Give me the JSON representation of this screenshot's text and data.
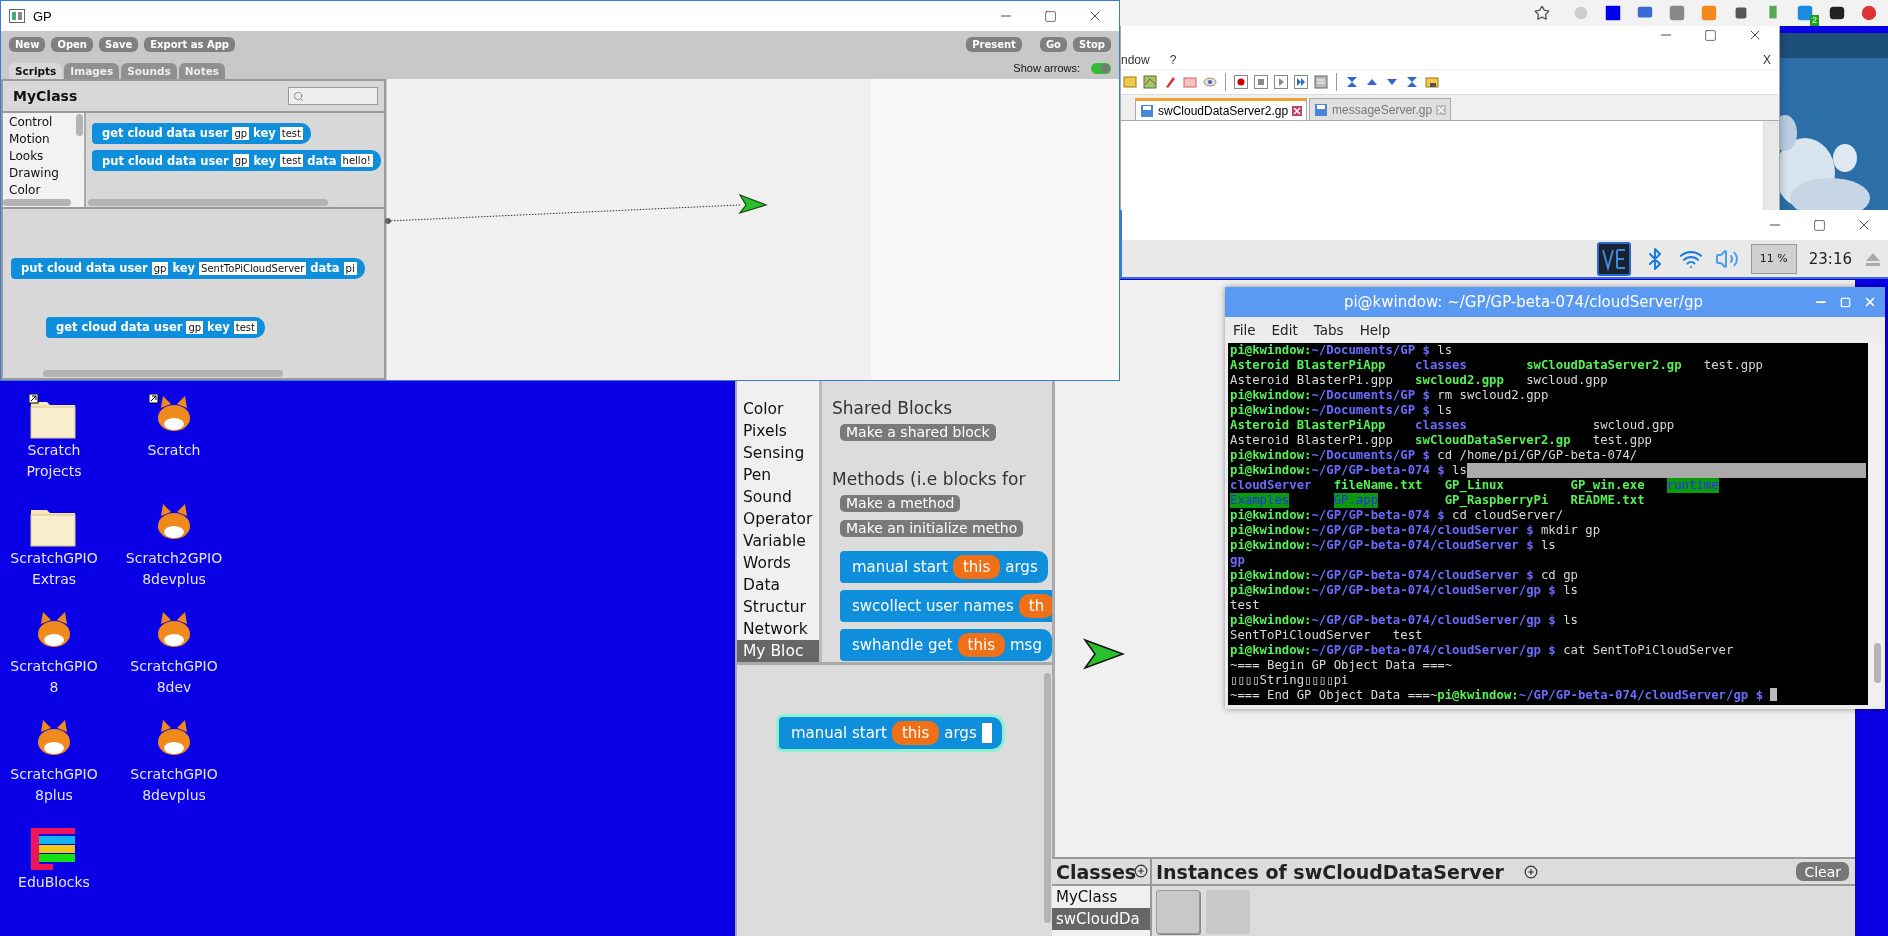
{
  "gp_window": {
    "title": "GP",
    "toolbar_left": [
      "New",
      "Open",
      "Save",
      "Export as App"
    ],
    "toolbar_right": [
      "Present",
      "Go",
      "Stop"
    ],
    "show_arrows": {
      "label": "Show arrows:",
      "on": true
    },
    "tabs": [
      {
        "label": "Scripts",
        "selected": true
      },
      {
        "label": "Images",
        "selected": false
      },
      {
        "label": "Sounds",
        "selected": false
      },
      {
        "label": "Notes",
        "selected": false
      }
    ],
    "class_name": "MyClass",
    "categories": [
      "Control",
      "Motion",
      "Looks",
      "Drawing",
      "Color"
    ],
    "palette_blocks": [
      {
        "parts": [
          {
            "kind": "label",
            "text": "get cloud data user"
          },
          {
            "kind": "slot",
            "text": "gp"
          },
          {
            "kind": "label",
            "text": "key"
          },
          {
            "kind": "slot",
            "text": "test"
          }
        ]
      },
      {
        "parts": [
          {
            "kind": "label",
            "text": "put cloud data user"
          },
          {
            "kind": "slot",
            "text": "gp"
          },
          {
            "kind": "label",
            "text": "key"
          },
          {
            "kind": "slot",
            "text": "test"
          },
          {
            "kind": "label",
            "text": "data"
          },
          {
            "kind": "slot",
            "text": "hello!"
          }
        ]
      }
    ],
    "script_blocks": [
      {
        "parts": [
          {
            "kind": "label",
            "text": "put cloud data user"
          },
          {
            "kind": "slot",
            "text": "gp"
          },
          {
            "kind": "label",
            "text": "key"
          },
          {
            "kind": "slot",
            "text": "SentToPiCloudServer"
          },
          {
            "kind": "label",
            "text": "data"
          },
          {
            "kind": "slot",
            "text": "pi"
          }
        ]
      },
      {
        "parts": [
          {
            "kind": "label",
            "text": "get cloud data user"
          },
          {
            "kind": "slot",
            "text": "gp"
          },
          {
            "kind": "label",
            "text": "key"
          },
          {
            "kind": "slot",
            "text": "test"
          }
        ]
      }
    ]
  },
  "browser": {
    "badge": "2"
  },
  "editor": {
    "menu": [
      "ndow",
      "?"
    ],
    "close_label": "X",
    "tabs": [
      {
        "label": "swCloudDataServer2.gp",
        "selected": true
      },
      {
        "label": "messageServer.gp",
        "selected": false
      }
    ]
  },
  "pi_panel": {
    "cpu": "11 %",
    "clock": "23:16"
  },
  "desktop": {
    "icons": [
      {
        "kind": "folder",
        "shortcut": true,
        "lines": [
          "Scratch",
          "Projects"
        ]
      },
      {
        "kind": "cat",
        "shortcut": true,
        "lines": [
          "Scratch"
        ]
      },
      {
        "kind": "folder",
        "shortcut": false,
        "lines": [
          "ScratchGPIO",
          "Extras"
        ]
      },
      {
        "kind": "cat",
        "shortcut": false,
        "lines": [
          "Scratch2GPIO",
          "8devplus"
        ]
      },
      {
        "kind": "cat",
        "shortcut": false,
        "lines": [
          "ScratchGPIO",
          "8"
        ]
      },
      {
        "kind": "cat",
        "shortcut": false,
        "lines": [
          "ScratchGPIO",
          "8dev"
        ]
      },
      {
        "kind": "cat",
        "shortcut": false,
        "lines": [
          "ScratchGPIO",
          "8plus"
        ]
      },
      {
        "kind": "cat",
        "shortcut": false,
        "lines": [
          "ScratchGPIO",
          "8devplus"
        ]
      },
      {
        "kind": "edublocks",
        "shortcut": false,
        "lines": [
          "EduBlocks"
        ]
      }
    ]
  },
  "pi_gp": {
    "categories": [
      {
        "label": "Color",
        "selected": false
      },
      {
        "label": "Pixels",
        "selected": false
      },
      {
        "label": "Sensing",
        "selected": false
      },
      {
        "label": "Pen",
        "selected": false
      },
      {
        "label": "Sound",
        "selected": false
      },
      {
        "label": "Operator",
        "selected": false
      },
      {
        "label": "Variable",
        "selected": false
      },
      {
        "label": "Words",
        "selected": false
      },
      {
        "label": "Data",
        "selected": false
      },
      {
        "label": "Structur",
        "selected": false
      },
      {
        "label": "Network",
        "selected": false
      },
      {
        "label": "My Bloc",
        "selected": true
      }
    ],
    "shared_heading": "Shared Blocks",
    "shared_button": "Make a shared block",
    "methods_heading": "Methods (i.e blocks for",
    "method_buttons": [
      "Make a method",
      "Make an initialize metho"
    ],
    "palette_blocks": [
      {
        "parts": [
          {
            "kind": "label",
            "text": "manual start"
          },
          {
            "kind": "var",
            "text": "this"
          },
          {
            "kind": "label",
            "text": "args"
          }
        ]
      },
      {
        "parts": [
          {
            "kind": "label",
            "text": "swcollect user names"
          },
          {
            "kind": "var",
            "text": "th"
          }
        ]
      },
      {
        "parts": [
          {
            "kind": "label",
            "text": "swhandle get"
          },
          {
            "kind": "var",
            "text": "this"
          },
          {
            "kind": "label",
            "text": "msg"
          }
        ]
      }
    ],
    "script_blocks": [
      {
        "highlighted": true,
        "parts": [
          {
            "kind": "label",
            "text": "manual start"
          },
          {
            "kind": "var",
            "text": "this"
          },
          {
            "kind": "label",
            "text": "args"
          },
          {
            "kind": "empty"
          }
        ]
      }
    ],
    "classes": {
      "title": "Classes",
      "items": [
        {
          "label": "MyClass",
          "selected": false
        },
        {
          "label": "swCloudDa",
          "selected": true
        }
      ]
    },
    "instances": {
      "title": "Instances of swCloudDataServer",
      "clear": "Clear",
      "items": [
        {
          "selected": true
        },
        {
          "selected": false
        }
      ]
    }
  },
  "terminal": {
    "title": "pi@kwindow: ~/GP/GP-beta-074/cloudServer/gp",
    "menu": [
      "File",
      "Edit",
      "Tabs",
      "Help"
    ],
    "lines": [
      {
        "segments": [
          {
            "kind": "user",
            "text": "pi@kwindow:"
          },
          {
            "kind": "path",
            "text": "~/Documents/GP $"
          },
          {
            "kind": "plain",
            "text": " ls"
          }
        ]
      },
      {
        "cells": [
          {
            "kind": "exec",
            "text": "Asteroid BlasterPiApp"
          },
          {
            "kind": "dir",
            "text": "classes"
          },
          {
            "kind": "exec",
            "text": "swCloudDataServer2.gp"
          },
          {
            "kind": "plain",
            "text": "test.gpp"
          }
        ]
      },
      {
        "cells": [
          {
            "kind": "plain",
            "text": "Asteroid BlasterPi.gpp"
          },
          {
            "kind": "exec",
            "text": "swcloud2.gpp"
          },
          {
            "kind": "plain",
            "text": "swcloud.gpp"
          }
        ]
      },
      {
        "segments": [
          {
            "kind": "user",
            "text": "pi@kwindow:"
          },
          {
            "kind": "path",
            "text": "~/Documents/GP $"
          },
          {
            "kind": "plain",
            "text": " rm swcloud2.gpp"
          }
        ]
      },
      {
        "segments": [
          {
            "kind": "user",
            "text": "pi@kwindow:"
          },
          {
            "kind": "path",
            "text": "~/Documents/GP $"
          },
          {
            "kind": "plain",
            "text": " ls"
          }
        ]
      },
      {
        "cells": [
          {
            "kind": "exec",
            "text": "Asteroid BlasterPiApp"
          },
          {
            "kind": "dir",
            "text": "classes"
          },
          {
            "kind": "plain",
            "text": "swcloud.gpp"
          }
        ]
      },
      {
        "cells": [
          {
            "kind": "plain",
            "text": "Asteroid BlasterPi.gpp"
          },
          {
            "kind": "exec",
            "text": "swCloudDataServer2.gp"
          },
          {
            "kind": "plain",
            "text": "test.gpp"
          }
        ]
      },
      {
        "segments": [
          {
            "kind": "user",
            "text": "pi@kwindow:"
          },
          {
            "kind": "path",
            "text": "~/Documents/GP $"
          },
          {
            "kind": "plain",
            "text": " cd /home/pi/GP/GP-beta-074/"
          }
        ]
      },
      {
        "selection": true,
        "segments": [
          {
            "kind": "user",
            "text": "pi@kwindow:"
          },
          {
            "kind": "path",
            "text": "~/GP/GP-beta-074 $"
          },
          {
            "kind": "plain",
            "text": " ls"
          }
        ]
      },
      {
        "cells": [
          {
            "kind": "dir",
            "text": "cloudServer"
          },
          {
            "kind": "exec",
            "text": "fileName.txt"
          },
          {
            "kind": "exec",
            "text": "GP_Linux"
          },
          {
            "kind": "exec",
            "text": "GP_win.exe"
          },
          {
            "kind": "marked",
            "text": "runtime"
          }
        ]
      },
      {
        "cells": [
          {
            "kind": "marked",
            "text": "Examples"
          },
          {
            "kind": "marked",
            "text": "GP.app"
          },
          {
            "kind": "exec",
            "text": "GP_RaspberryPi"
          },
          {
            "kind": "exec",
            "text": "README.txt"
          }
        ]
      },
      {
        "segments": [
          {
            "kind": "user",
            "text": "pi@kwindow:"
          },
          {
            "kind": "path",
            "text": "~/GP/GP-beta-074 $"
          },
          {
            "kind": "plain",
            "text": " cd cloudServer/"
          }
        ]
      },
      {
        "segments": [
          {
            "kind": "user",
            "text": "pi@kwindow:"
          },
          {
            "kind": "path",
            "text": "~/GP/GP-beta-074/cloudServer $"
          },
          {
            "kind": "plain",
            "text": " mkdir gp"
          }
        ]
      },
      {
        "segments": [
          {
            "kind": "user",
            "text": "pi@kwindow:"
          },
          {
            "kind": "path",
            "text": "~/GP/GP-beta-074/cloudServer $"
          },
          {
            "kind": "plain",
            "text": " ls"
          }
        ]
      },
      {
        "cells": [
          {
            "kind": "dir",
            "text": "gp"
          }
        ]
      },
      {
        "segments": [
          {
            "kind": "user",
            "text": "pi@kwindow:"
          },
          {
            "kind": "path",
            "text": "~/GP/GP-beta-074/cloudServer $"
          },
          {
            "kind": "plain",
            "text": " cd gp"
          }
        ]
      },
      {
        "segments": [
          {
            "kind": "user",
            "text": "pi@kwindow:"
          },
          {
            "kind": "path",
            "text": "~/GP/GP-beta-074/cloudServer/gp $"
          },
          {
            "kind": "plain",
            "text": " ls"
          }
        ]
      },
      {
        "cells": [
          {
            "kind": "plain",
            "text": "test"
          }
        ]
      },
      {
        "segments": [
          {
            "kind": "user",
            "text": "pi@kwindow:"
          },
          {
            "kind": "path",
            "text": "~/GP/GP-beta-074/cloudServer/gp $"
          },
          {
            "kind": "plain",
            "text": " ls"
          }
        ]
      },
      {
        "cells": [
          {
            "kind": "plain",
            "text": "SentToPiCloudServer"
          },
          {
            "kind": "plain",
            "text": "test"
          }
        ]
      },
      {
        "segments": [
          {
            "kind": "user",
            "text": "pi@kwindow:"
          },
          {
            "kind": "path",
            "text": "~/GP/GP-beta-074/cloudServer/gp $"
          },
          {
            "kind": "plain",
            "text": " cat SentToPiCloudServer"
          }
        ]
      },
      {
        "segments": [
          {
            "kind": "plain",
            "text": "~=== Begin GP Object Data ===~"
          }
        ]
      },
      {
        "segments": [
          {
            "kind": "plain",
            "text": "▯▯▯▯String▯▯▯▯pi"
          }
        ]
      },
      {
        "cursor": true,
        "segments": [
          {
            "kind": "plain",
            "text": "~=== End GP Object Data ===~"
          },
          {
            "kind": "user",
            "text": "pi@kwindow:"
          },
          {
            "kind": "path",
            "text": "~/GP/GP-beta-074/cloudServer/gp $"
          }
        ]
      }
    ]
  }
}
